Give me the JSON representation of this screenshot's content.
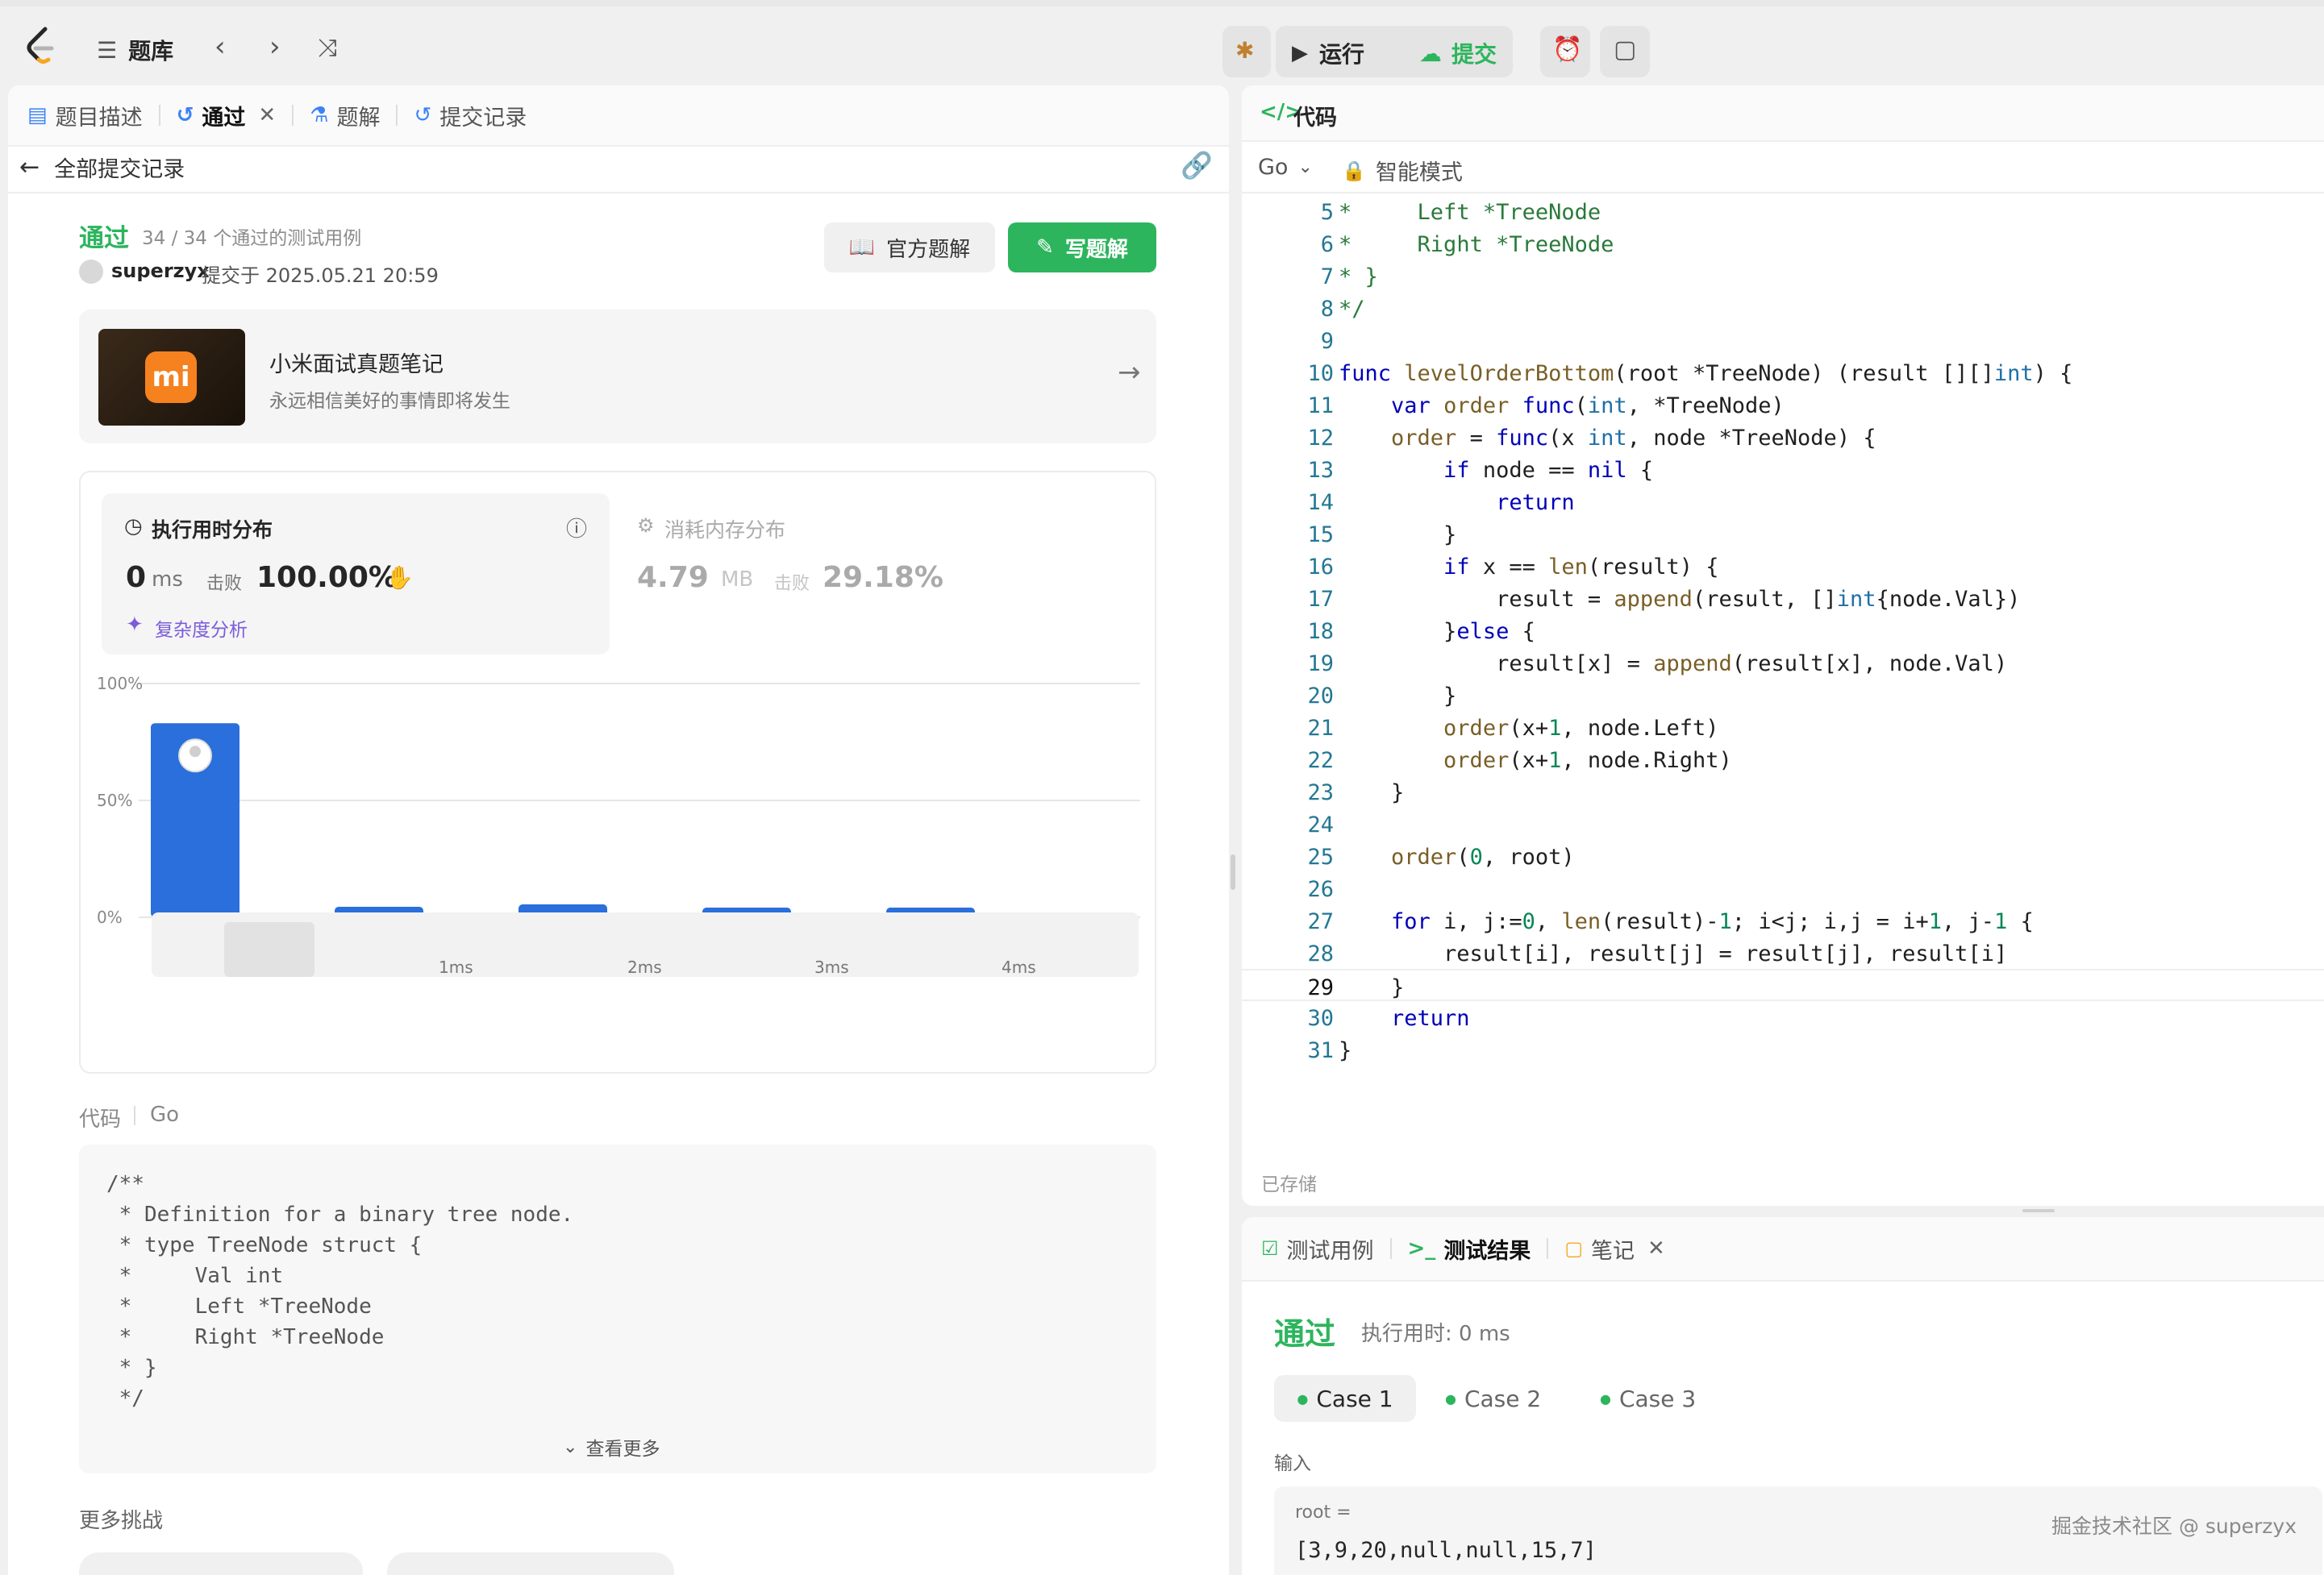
{
  "topbar": {
    "problem_bank": "题库",
    "run": "运行",
    "submit": "提交"
  },
  "left": {
    "tabs": [
      {
        "label": "题目描述"
      },
      {
        "label": "通过"
      },
      {
        "label": "题解"
      },
      {
        "label": "提交记录"
      }
    ],
    "back_label": "全部提交记录",
    "status": "通过",
    "testcases": "34 / 34 个通过的测试用例",
    "user": "superzyx",
    "submitted_at": "提交于 2025.05.21 20:59",
    "official_solution": "官方题解",
    "write_solution": "写题解",
    "promo": {
      "title": "小米面试真题笔记",
      "subtitle": "永远相信美好的事情即将发生"
    },
    "runtime": {
      "label": "执行用时分布",
      "value": "0",
      "unit": "ms",
      "beats_label": "击败",
      "beats": "100.00%",
      "complexity": "复杂度分析"
    },
    "memory": {
      "label": "消耗内存分布",
      "value": "4.79",
      "unit": "MB",
      "beats_label": "击败",
      "beats": "29.18%"
    },
    "code_label": "代码",
    "code_lang": "Go",
    "code_preview": [
      "/**",
      " * Definition for a binary tree node.",
      " * type TreeNode struct {",
      " *     Val int",
      " *     Left *TreeNode",
      " *     Right *TreeNode",
      " * }",
      " */"
    ],
    "see_more": "查看更多",
    "more_challenges": "更多挑战"
  },
  "chart_data": {
    "type": "bar",
    "categories": [
      "0ms",
      "1ms",
      "2ms",
      "3ms",
      "4ms"
    ],
    "tick_labels": [
      "",
      "1ms",
      "2ms",
      "3ms",
      "4ms"
    ],
    "values": [
      83,
      4.5,
      5.5,
      3.5,
      3.5
    ],
    "ylim": [
      0,
      100
    ],
    "y_ticks": [
      "100%",
      "50%",
      "0%"
    ],
    "color": "#2a6fdb",
    "grid": true
  },
  "editor": {
    "title": "代码",
    "lang": "Go",
    "mode": "智能模式",
    "saved": "已存储",
    "lines": [
      {
        "n": "5",
        "t": "*     Left *TreeNode"
      },
      {
        "n": "6",
        "t": "*     Right *TreeNode"
      },
      {
        "n": "7",
        "t": "* }"
      },
      {
        "n": "8",
        "t": "*/"
      },
      {
        "n": "9",
        "t": ""
      },
      {
        "n": "10",
        "t": "func levelOrderBottom(root *TreeNode) (result [][]int) {"
      },
      {
        "n": "11",
        "t": "    var order func(int, *TreeNode)"
      },
      {
        "n": "12",
        "t": "    order = func(x int, node *TreeNode) {"
      },
      {
        "n": "13",
        "t": "        if node == nil {"
      },
      {
        "n": "14",
        "t": "            return"
      },
      {
        "n": "15",
        "t": "        }"
      },
      {
        "n": "16",
        "t": "        if x == len(result) {"
      },
      {
        "n": "17",
        "t": "            result = append(result, []int{node.Val})"
      },
      {
        "n": "18",
        "t": "        }else {"
      },
      {
        "n": "19",
        "t": "            result[x] = append(result[x], node.Val)"
      },
      {
        "n": "20",
        "t": "        }"
      },
      {
        "n": "21",
        "t": "        order(x+1, node.Left)"
      },
      {
        "n": "22",
        "t": "        order(x+1, node.Right)"
      },
      {
        "n": "23",
        "t": "    }"
      },
      {
        "n": "24",
        "t": ""
      },
      {
        "n": "25",
        "t": "    order(0, root)"
      },
      {
        "n": "26",
        "t": ""
      },
      {
        "n": "27",
        "t": "    for i, j:=0, len(result)-1; i<j; i,j = i+1, j-1 {"
      },
      {
        "n": "28",
        "t": "        result[i], result[j] = result[j], result[i]"
      },
      {
        "n": "29",
        "t": "    }"
      },
      {
        "n": "30",
        "t": "    return"
      },
      {
        "n": "31",
        "t": "}"
      }
    ]
  },
  "bottom": {
    "tabs": [
      {
        "label": "测试用例"
      },
      {
        "label": "测试结果"
      },
      {
        "label": "笔记"
      }
    ],
    "status": "通过",
    "runtime": "执行用时: 0 ms",
    "cases": [
      "Case 1",
      "Case 2",
      "Case 3"
    ],
    "input_label": "输入",
    "var_label": "root =",
    "input_value": "[3,9,20,null,null,15,7]",
    "watermark": "掘金技术社区 @ superzyx"
  }
}
